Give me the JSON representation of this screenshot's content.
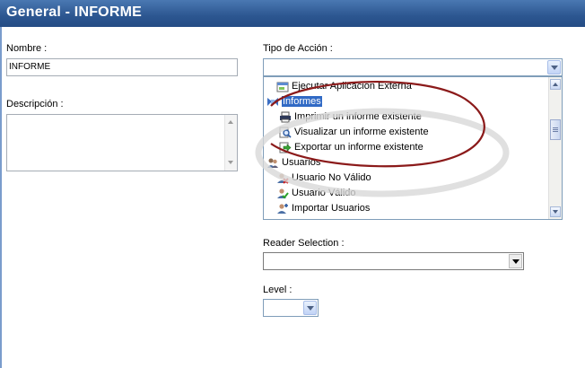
{
  "title": "General - INFORME",
  "labels": {
    "nombre": "Nombre :",
    "descripcion": "Descripción :",
    "tipo_accion": "Tipo de Acción :",
    "reader_selection": "Reader Selection :",
    "level": "Level :"
  },
  "nombre_value": "INFORME",
  "tipo_accion_value": "",
  "reader_selection_value": "",
  "level_value": "",
  "action_list": [
    {
      "label": "Ejecutar Aplicación Externa",
      "icon": "application-icon"
    },
    {
      "label": "Informes",
      "icon": "reports-category-icon",
      "selected": true
    },
    {
      "label": "Imprimir un informe existente",
      "icon": "printer-icon"
    },
    {
      "label": "Visualizar un informe existente",
      "icon": "magnifier-document-icon"
    },
    {
      "label": "Exportar un informe existente",
      "icon": "export-document-icon"
    },
    {
      "label": "Usuarios",
      "icon": "users-icon"
    },
    {
      "label": "Usuario No Válido",
      "icon": "invalid-user-icon"
    },
    {
      "label": "Usuario Válido",
      "icon": "valid-user-icon"
    },
    {
      "label": "Importar Usuarios",
      "icon": "import-users-icon"
    }
  ],
  "colors": {
    "title_bar": "#2c5690",
    "selection": "#316ac5",
    "annotation_circle": "#8b1a1a"
  }
}
